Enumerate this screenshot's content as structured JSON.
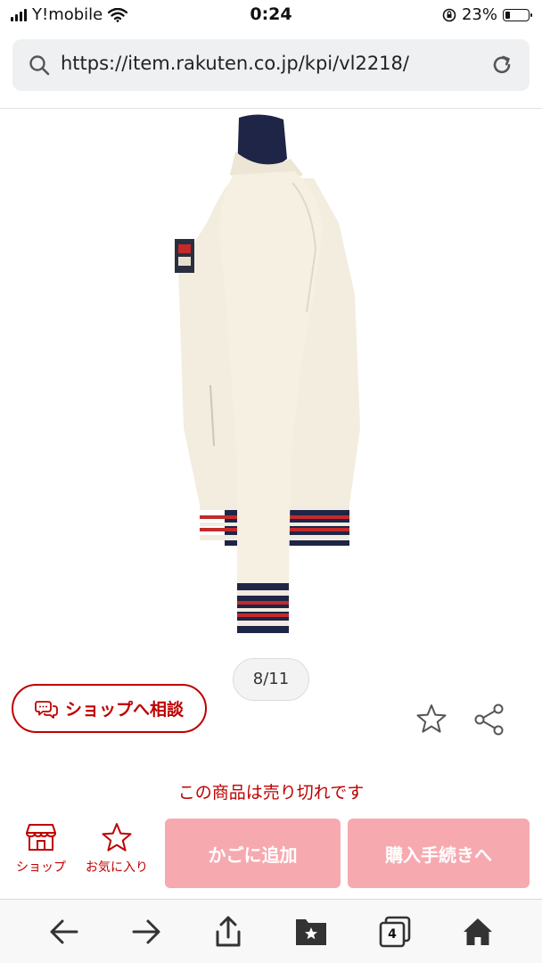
{
  "status_bar": {
    "carrier": "Y!mobile",
    "time": "0:24",
    "battery_percent": "23%",
    "battery_level": 0.23
  },
  "browser": {
    "url": "https://item.rakuten.co.jp/kpi/vl2218/"
  },
  "gallery": {
    "counter": "8/11"
  },
  "actions": {
    "consult_label": "ショップへ相談"
  },
  "product": {
    "soldout_text": "この商品は売り切れです"
  },
  "bottom_nav": {
    "shop_label": "ショップ",
    "favorite_label": "お気に入り",
    "cart_label": "かごに追加",
    "buy_label": "購入手続きへ"
  },
  "toolbar": {
    "tab_count": "4"
  },
  "colors": {
    "brand_red": "#bf0000",
    "disabled_pink": "#f7a9b0"
  }
}
